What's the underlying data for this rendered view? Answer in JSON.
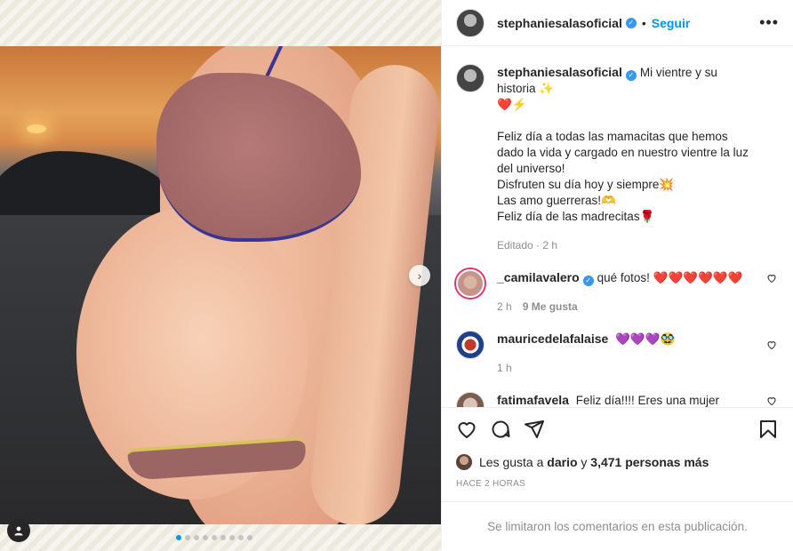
{
  "author": {
    "username": "stephaniesalasoficial",
    "follow_label": "Seguir",
    "more_label": "•••"
  },
  "caption": {
    "line1": "Mi vientre y su historia ✨",
    "line2": "❤️⚡",
    "line3": "Feliz día a todas las mamacitas que hemos dado la vida y cargado en nuestro vientre la luz del universo!",
    "line4": "Disfruten su día hoy y siempre💥",
    "line5": "Las amo guerreras!🫶",
    "line6": "Feliz día de las madrecitas🌹",
    "meta": "Editado · 2 h"
  },
  "comments": [
    {
      "username": "_camilavalero",
      "text": "qué fotos! ❤️❤️❤️❤️❤️❤️",
      "time": "2 h",
      "likes": "9 Me gusta"
    },
    {
      "username": "mauricedelafalaise",
      "text": "💜💜💜🥸",
      "time": "1 h"
    },
    {
      "username": "fatimafavela",
      "text": "Feliz día!!!! Eres una mujer increíble!!! Y la mamá más cool!!! 😎"
    }
  ],
  "likes": {
    "prefix": "Les gusta a",
    "user": "dario",
    "connector": "y",
    "count": "3,471 personas más"
  },
  "time_ago": "HACE 2 HORAS",
  "limited_comments": "Se limitaron los comentarios en esta publicación.",
  "carousel": {
    "total": 9,
    "active": 0
  },
  "colors": {
    "accent": "#0095f6",
    "verified": "#3897f0"
  },
  "icons": [
    "heart-icon",
    "comment-icon",
    "share-icon",
    "bookmark-icon",
    "user-tag-icon",
    "chevron-right-icon",
    "verified-icon"
  ]
}
